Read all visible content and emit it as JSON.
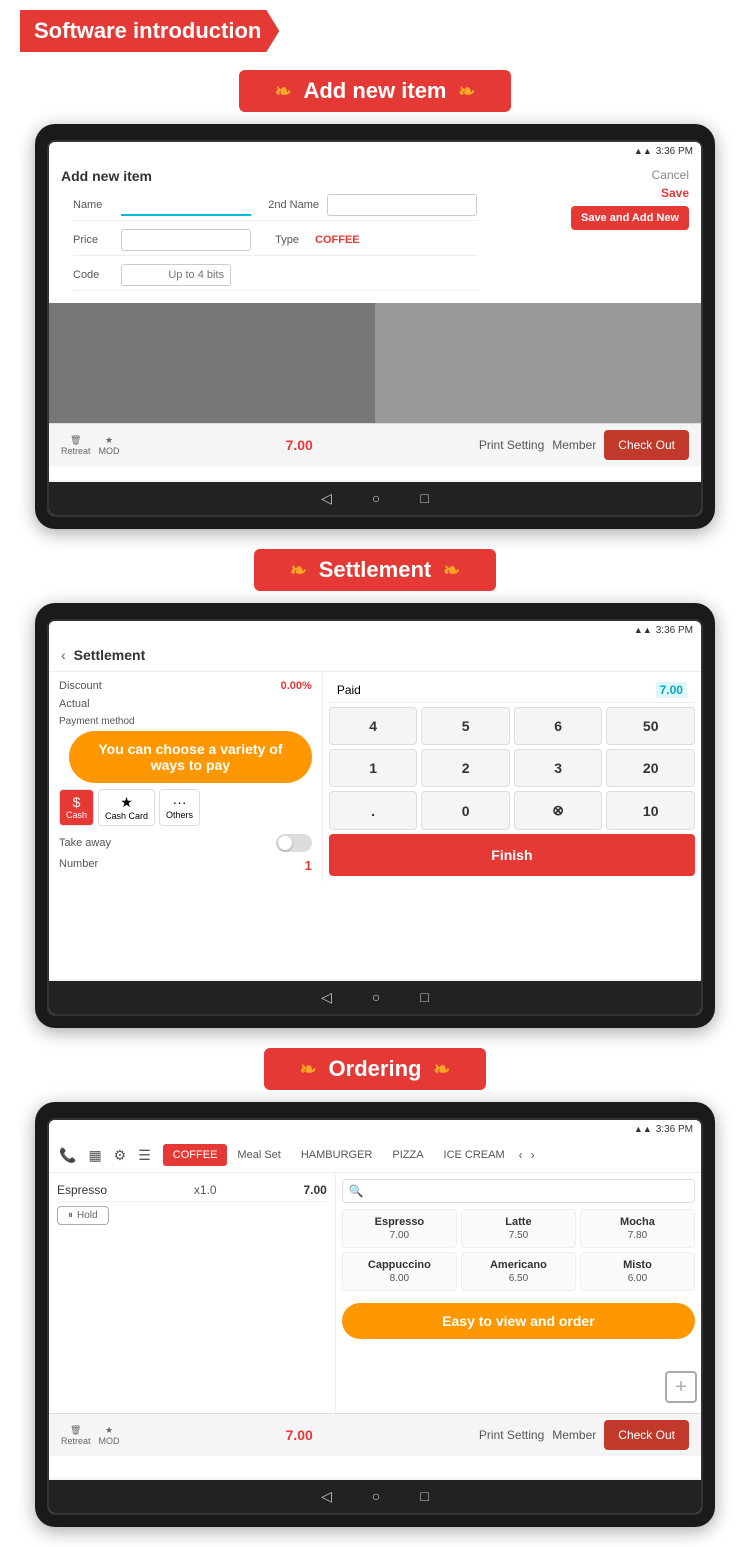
{
  "header": {
    "title": "Software introduction"
  },
  "sections": [
    {
      "id": "add-item",
      "title": "Add new item",
      "screen": {
        "status_time": "3:36 PM",
        "form_title": "Add new item",
        "btn_cancel": "Cancel",
        "btn_save": "Save",
        "btn_save_add": "Save and Add New",
        "fields": [
          {
            "label": "Name",
            "placeholder": "",
            "second_label": "2nd Name",
            "second_value": ""
          },
          {
            "label": "Price",
            "placeholder": "",
            "second_label": "Type",
            "second_value": "COFFEE"
          },
          {
            "label": "Code",
            "placeholder": "Up to 4 bits",
            "second_label": "",
            "second_value": ""
          }
        ],
        "bottom": {
          "retreat_label": "Retreat",
          "mod_label": "MOD",
          "amount": "7.00",
          "print_setting": "Print Setting",
          "member": "Member",
          "checkout": "Check Out"
        }
      }
    },
    {
      "id": "settlement",
      "title": "Settlement",
      "screen": {
        "status_time": "3:36 PM",
        "back": "<",
        "title": "Settlement",
        "discount_label": "Discount",
        "discount_val": "0.00%",
        "paid_label": "Paid",
        "paid_val": "7.00",
        "actual_label": "Actual",
        "payment_label": "Payment method",
        "payment_methods": [
          "Cash",
          "Cash Card",
          "Others"
        ],
        "tooltip": "You can choose a variety of ways to pay",
        "take_away_label": "Take away",
        "number_label": "Number",
        "number_val": "1",
        "keypad": [
          "4",
          "5",
          "6",
          "50",
          "1",
          "2",
          "3",
          "20",
          ".",
          "0",
          "⊗",
          "10"
        ],
        "finish_btn": "Finish"
      }
    },
    {
      "id": "ordering",
      "title": "Ordering",
      "screen": {
        "status_time": "3:36 PM",
        "categories": [
          "COFFEE",
          "Meal Set",
          "HAMBURGER",
          "PIZZA",
          "ICE CREAM"
        ],
        "active_category": "COFFEE",
        "order_items": [
          {
            "name": "Espresso",
            "qty": "x1.0",
            "price": "7.00"
          }
        ],
        "hold_btn": "Hold",
        "menu_items": [
          {
            "name": "Espresso",
            "price": "7.00"
          },
          {
            "name": "Latte",
            "price": "7.50"
          },
          {
            "name": "Mocha",
            "price": "7.80"
          },
          {
            "name": "Cappuccino",
            "price": "8.00"
          },
          {
            "name": "Americano",
            "price": "6.50"
          },
          {
            "name": "Misto",
            "price": "6.00"
          }
        ],
        "tooltip": "Easy to view and order",
        "bottom": {
          "retreat_label": "Retreat",
          "mod_label": "MOD",
          "amount": "7.00",
          "print_setting": "Print Setting",
          "member": "Member",
          "checkout": "Check Out"
        }
      }
    }
  ]
}
